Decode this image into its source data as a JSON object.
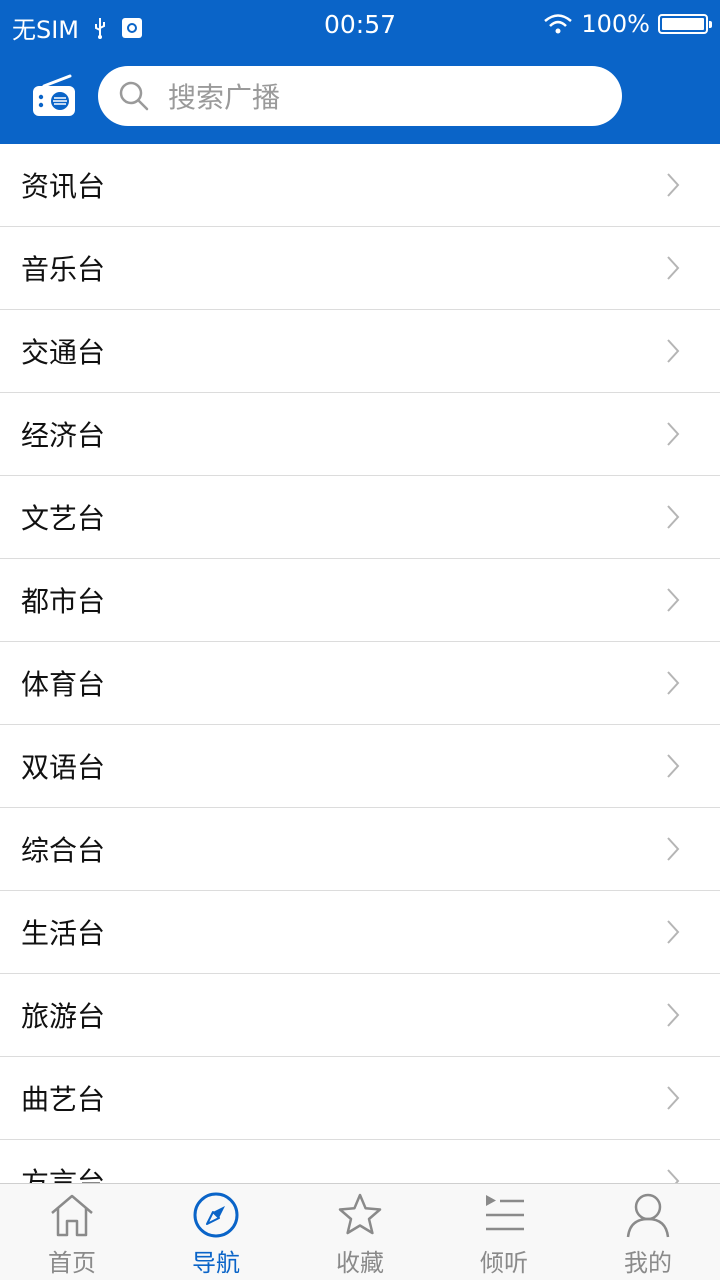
{
  "status_bar": {
    "carrier": "无SIM",
    "time": "00:57",
    "battery": "100%"
  },
  "header": {
    "search_placeholder": "搜索广播",
    "radio_icon": "radio-icon"
  },
  "list": {
    "items": [
      "资讯台",
      "音乐台",
      "交通台",
      "经济台",
      "文艺台",
      "都市台",
      "体育台",
      "双语台",
      "综合台",
      "生活台",
      "旅游台",
      "曲艺台",
      "方言台"
    ]
  },
  "tabbar": {
    "active": "导航",
    "tabs": [
      {
        "label": "首页",
        "icon": "home-icon"
      },
      {
        "label": "导航",
        "icon": "compass-icon"
      },
      {
        "label": "收藏",
        "icon": "star-icon"
      },
      {
        "label": "倾听",
        "icon": "playlist-icon"
      },
      {
        "label": "我的",
        "icon": "user-icon"
      }
    ]
  },
  "colors": {
    "brand": "#0a64c8",
    "inactive": "#8a8a8a"
  }
}
